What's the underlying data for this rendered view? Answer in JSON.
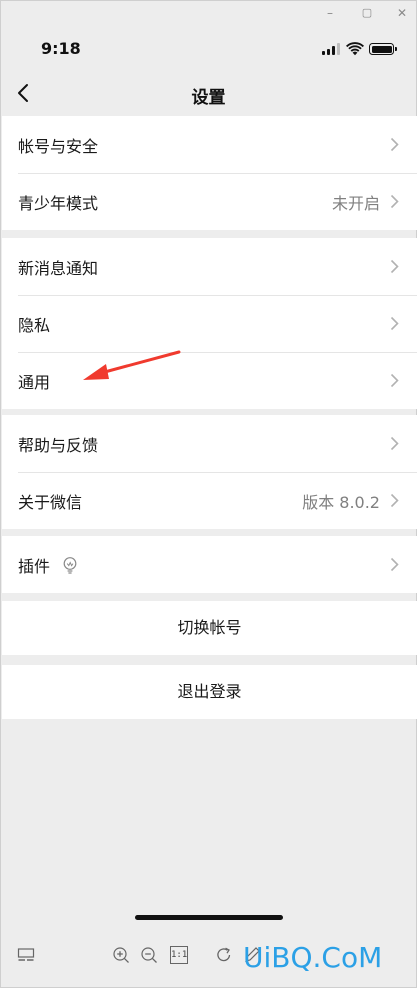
{
  "window": {
    "minimize": "–",
    "maximize": "▢",
    "close": "✕"
  },
  "status": {
    "time": "9:18"
  },
  "nav": {
    "title": "设置"
  },
  "groups": {
    "g1": [
      {
        "label": "帐号与安全",
        "value": ""
      },
      {
        "label": "青少年模式",
        "value": "未开启"
      }
    ],
    "g2": [
      {
        "label": "新消息通知"
      },
      {
        "label": "隐私"
      },
      {
        "label": "通用"
      }
    ],
    "g3": [
      {
        "label": "帮助与反馈",
        "value": ""
      },
      {
        "label": "关于微信",
        "value": "版本 8.0.2"
      }
    ],
    "g4": [
      {
        "label": "插件"
      }
    ]
  },
  "actions": {
    "switch_account": "切换帐号",
    "logout": "退出登录"
  },
  "toolbar": {
    "icons": [
      "layout-icon",
      "zoom-in-icon",
      "zoom-out-icon",
      "actual-size-icon",
      "rotate-icon",
      "pen-icon",
      "save-icon"
    ],
    "one_to_one": "1:1"
  },
  "watermark": "UiBQ.CoM",
  "colors": {
    "background": "#ededed",
    "row": "#ffffff",
    "annotation_arrow": "#f03a2e",
    "watermark": "#2ba0e6"
  }
}
